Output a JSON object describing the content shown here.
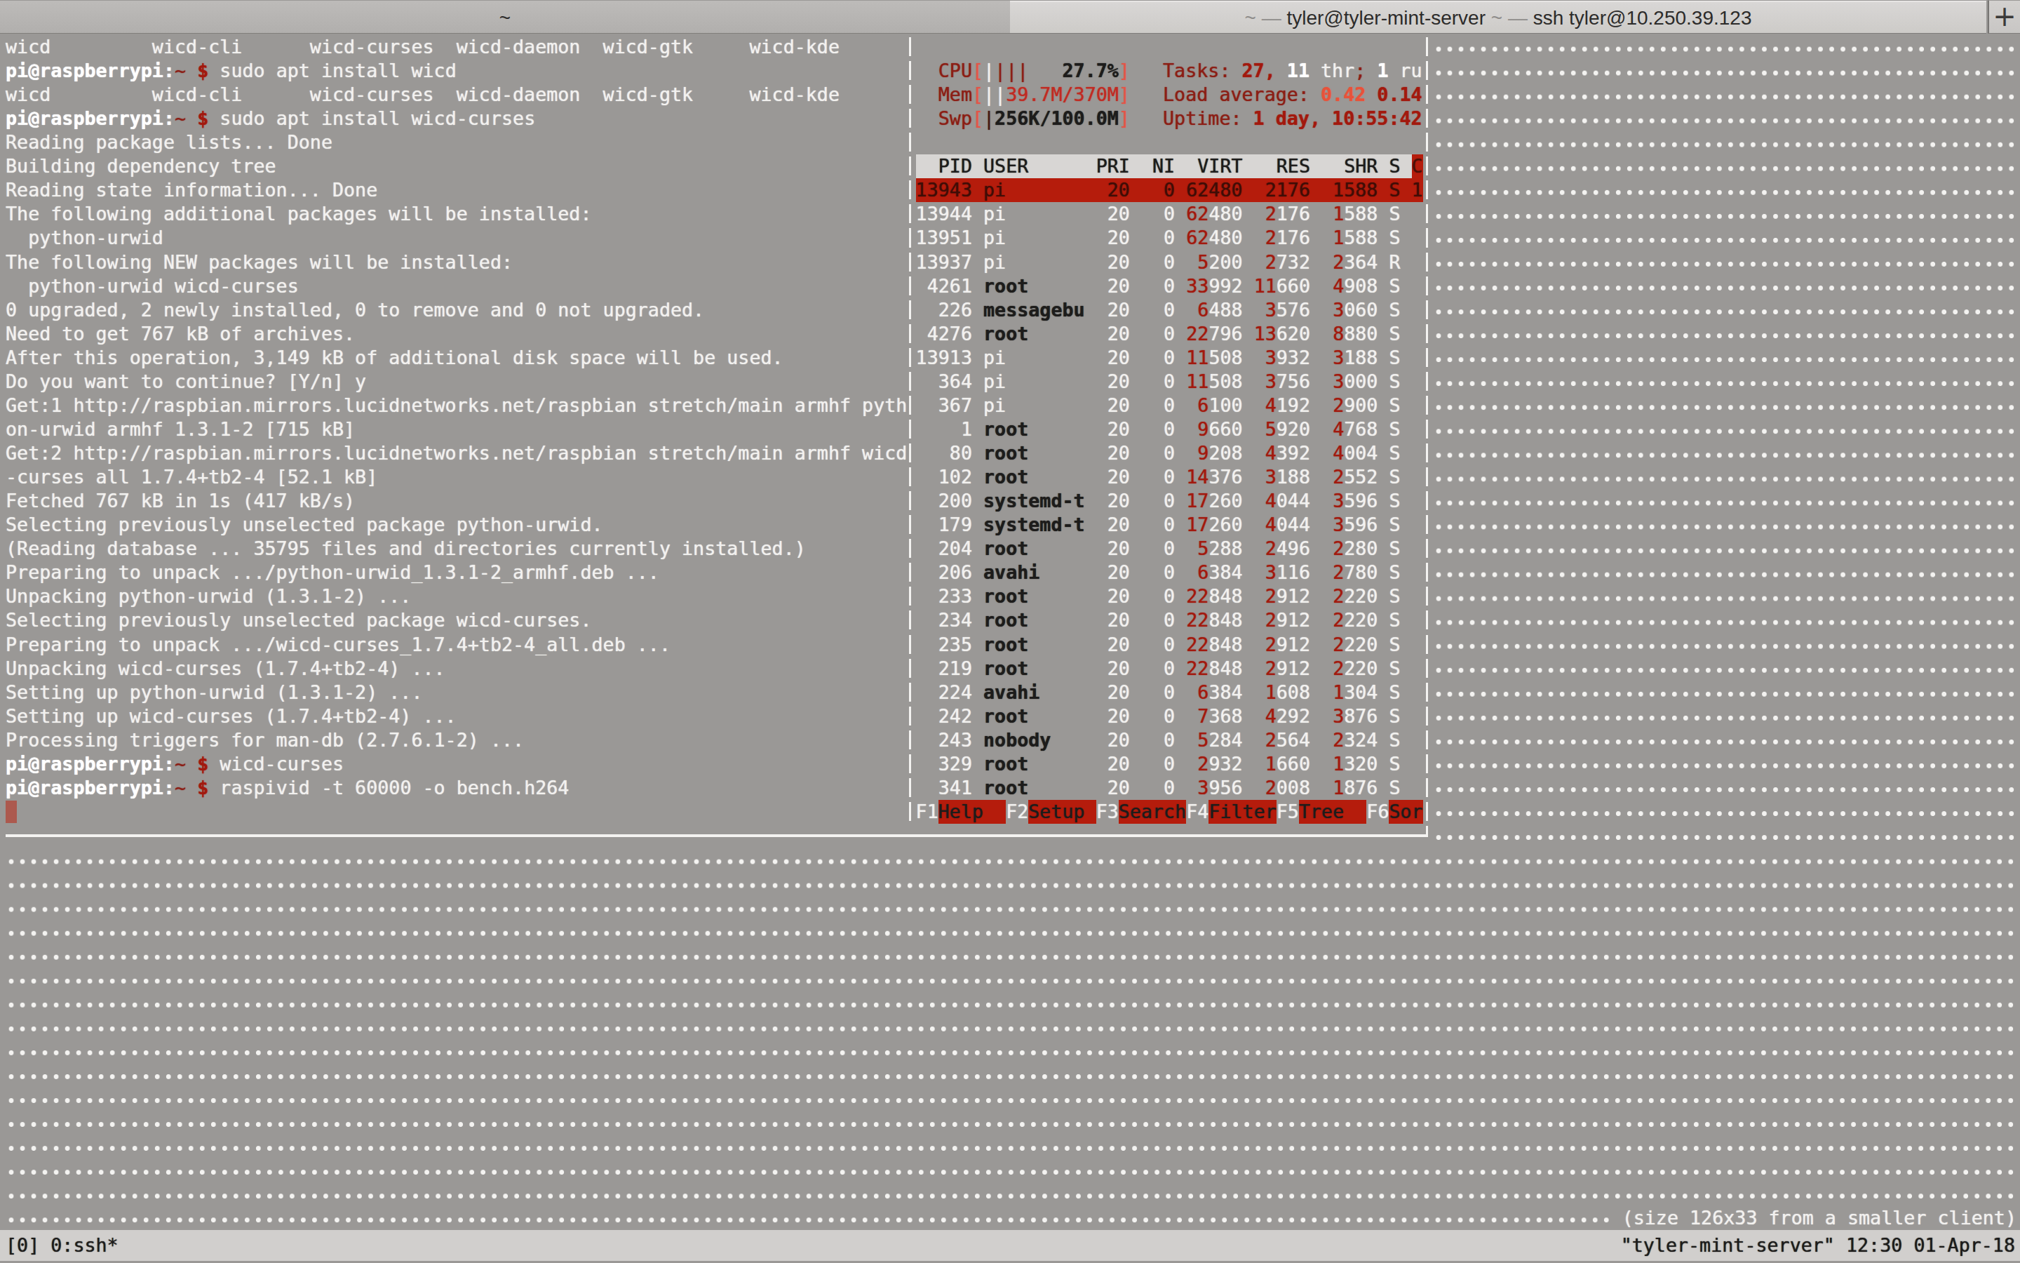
{
  "tabs": [
    {
      "title": "~",
      "active": false
    },
    {
      "title": "~ — tyler@tyler-mint-server ~ — ssh tyler@10.250.39.123",
      "active": true,
      "segments": [
        [
          "~ — ",
          "dim"
        ],
        [
          "tyler@tyler-mint-server",
          ""
        ],
        [
          " ~ — ",
          "dim"
        ],
        [
          "ssh tyler@10.250.39.123",
          ""
        ]
      ]
    }
  ],
  "new_tab_label": "+",
  "colors": {
    "bg": "#9a9896",
    "fg": "#f2f1ef",
    "boldfg": "#ffffff",
    "maroon": "#8b1e15",
    "crimson": "#a2190e",
    "bracket": "#e25548",
    "redval": "#c02b23",
    "tomato": "#e8523a",
    "black": "#1d1c1b",
    "selbg": "#b51c0c",
    "seltext": "#400d06",
    "hdrbg": "#d8d6d4",
    "sortfg": "#4c0f07",
    "border": "#f4f3f1",
    "dot": "#f4f3f1",
    "cursor": "#ac594e",
    "statusbg": "#d1cfcd",
    "swpbar": "#451710",
    "tabfg": "#2c2b2a",
    "tabdim": "#8e8c8a"
  },
  "shell": {
    "lines": [
      [
        [
          "wicd         wicd-cli      wicd-curses  wicd-daemon  wicd-gtk     wicd-kde",
          "f"
        ]
      ],
      [
        [
          "pi@raspberrypi:",
          "b"
        ],
        [
          "~",
          "m"
        ],
        [
          " ",
          "f"
        ],
        [
          "$",
          "d"
        ],
        [
          " sudo apt install wicd",
          "f"
        ]
      ],
      [
        [
          "wicd         wicd-cli      wicd-curses  wicd-daemon  wicd-gtk     wicd-kde",
          "f"
        ]
      ],
      [
        [
          "pi@raspberrypi:",
          "b"
        ],
        [
          "~",
          "m"
        ],
        [
          " ",
          "f"
        ],
        [
          "$",
          "d"
        ],
        [
          " sudo apt install wicd-curses",
          "f"
        ]
      ],
      [
        [
          "Reading package lists... Done",
          "f"
        ]
      ],
      [
        [
          "Building dependency tree",
          "f"
        ]
      ],
      [
        [
          "Reading state information... Done",
          "f"
        ]
      ],
      [
        [
          "The following additional packages will be installed:",
          "f"
        ]
      ],
      [
        [
          "  python-urwid",
          "f"
        ]
      ],
      [
        [
          "The following NEW packages will be installed:",
          "f"
        ]
      ],
      [
        [
          "  python-urwid wicd-curses",
          "f"
        ]
      ],
      [
        [
          "0 upgraded, 2 newly installed, 0 to remove and 0 not upgraded.",
          "f"
        ]
      ],
      [
        [
          "Need to get 767 kB of archives.",
          "f"
        ]
      ],
      [
        [
          "After this operation, 3,149 kB of additional disk space will be used.",
          "f"
        ]
      ],
      [
        [
          "Do you want to continue? [Y/n] y",
          "f"
        ]
      ],
      [
        [
          "Get:1 http://raspbian.mirrors.lucidnetworks.net/raspbian stretch/main armhf pyth",
          "f"
        ]
      ],
      [
        [
          "on-urwid armhf 1.3.1-2 [715 kB]",
          "f"
        ]
      ],
      [
        [
          "Get:2 http://raspbian.mirrors.lucidnetworks.net/raspbian stretch/main armhf wicd",
          "f"
        ]
      ],
      [
        [
          "-curses all 1.7.4+tb2-4 [52.1 kB]",
          "f"
        ]
      ],
      [
        [
          "Fetched 767 kB in 1s (417 kB/s)",
          "f"
        ]
      ],
      [
        [
          "Selecting previously unselected package python-urwid.",
          "f"
        ]
      ],
      [
        [
          "(Reading database ... 35795 files and directories currently installed.)",
          "f"
        ]
      ],
      [
        [
          "Preparing to unpack .../python-urwid_1.3.1-2_armhf.deb ...",
          "f"
        ]
      ],
      [
        [
          "Unpacking python-urwid (1.3.1-2) ...",
          "f"
        ]
      ],
      [
        [
          "Selecting previously unselected package wicd-curses.",
          "f"
        ]
      ],
      [
        [
          "Preparing to unpack .../wicd-curses_1.7.4+tb2-4_all.deb ...",
          "f"
        ]
      ],
      [
        [
          "Unpacking wicd-curses (1.7.4+tb2-4) ...",
          "f"
        ]
      ],
      [
        [
          "Setting up python-urwid (1.3.1-2) ...",
          "f"
        ]
      ],
      [
        [
          "Setting up wicd-curses (1.7.4+tb2-4) ...",
          "f"
        ]
      ],
      [
        [
          "Processing triggers for man-db (2.7.6.1-2) ...",
          "f"
        ]
      ],
      [
        [
          "pi@raspberrypi:",
          "b"
        ],
        [
          "~",
          "m"
        ],
        [
          " ",
          "f"
        ],
        [
          "$",
          "d"
        ],
        [
          " wicd-curses",
          "f"
        ]
      ],
      [
        [
          "pi@raspberrypi:",
          "b"
        ],
        [
          "~",
          "m"
        ],
        [
          " ",
          "f"
        ],
        [
          "$",
          "d"
        ],
        [
          " raspivid -t 60000 -o bench.h264",
          "f"
        ]
      ]
    ],
    "cursor_row": 32
  },
  "htop": {
    "meters_left": [
      [
        [
          "  ",
          "f"
        ],
        [
          "CPU",
          "m"
        ],
        [
          "[",
          "r"
        ],
        [
          "|",
          "f"
        ],
        [
          "|||",
          "m"
        ],
        [
          "   ",
          "f"
        ],
        [
          "27.7%",
          "kb"
        ],
        [
          "]",
          "r"
        ]
      ],
      [
        [
          "  ",
          "f"
        ],
        [
          "Mem",
          "m"
        ],
        [
          "[",
          "r"
        ],
        [
          "||",
          "f"
        ],
        [
          "39.7M/370M",
          "rv"
        ],
        [
          "]",
          "r"
        ]
      ],
      [
        [
          "  ",
          "f"
        ],
        [
          "Swp",
          "m"
        ],
        [
          "[",
          "r"
        ],
        [
          "|",
          "sb"
        ],
        [
          "256K/100.0M",
          "kb"
        ],
        [
          "]",
          "r"
        ]
      ]
    ],
    "meters_right": [
      [
        [
          "Tasks: ",
          "m"
        ],
        [
          "27,",
          "cb"
        ],
        [
          " ",
          "f"
        ],
        [
          "11",
          "wb"
        ],
        [
          " thr",
          "f"
        ],
        [
          ";",
          "m"
        ],
        [
          " ",
          "f"
        ],
        [
          "1",
          "wb"
        ],
        [
          " ru",
          "f"
        ]
      ],
      [
        [
          "Load average: ",
          "m"
        ],
        [
          "0.42",
          "tb"
        ],
        [
          " ",
          "f"
        ],
        [
          "0.14",
          "cb"
        ]
      ],
      [
        [
          "Uptime: ",
          "m"
        ],
        [
          "1 day, 10:55:42",
          "cb"
        ]
      ]
    ],
    "header_cols": "  PID USER      PRI  NI  VIRT   RES   SHR S ",
    "sort_col": "C",
    "processes": [
      [
        13943,
        "pi",
        20,
        0,
        62480,
        2176,
        1588,
        "S",
        "1"
      ],
      [
        13944,
        "pi",
        20,
        0,
        62480,
        2176,
        1588,
        "S",
        " "
      ],
      [
        13951,
        "pi",
        20,
        0,
        62480,
        2176,
        1588,
        "S",
        " "
      ],
      [
        13937,
        "pi",
        20,
        0,
        5200,
        2732,
        2364,
        "R",
        " "
      ],
      [
        4261,
        "root",
        20,
        0,
        33992,
        11660,
        4908,
        "S",
        " "
      ],
      [
        226,
        "messagebu",
        20,
        0,
        6488,
        3576,
        3060,
        "S",
        " "
      ],
      [
        4276,
        "root",
        20,
        0,
        22796,
        13620,
        8880,
        "S",
        " "
      ],
      [
        13913,
        "pi",
        20,
        0,
        11508,
        3932,
        3188,
        "S",
        " "
      ],
      [
        364,
        "pi",
        20,
        0,
        11508,
        3756,
        3000,
        "S",
        " "
      ],
      [
        367,
        "pi",
        20,
        0,
        6100,
        4192,
        2900,
        "S",
        " "
      ],
      [
        1,
        "root",
        20,
        0,
        9660,
        5920,
        4768,
        "S",
        " "
      ],
      [
        80,
        "root",
        20,
        0,
        9208,
        4392,
        4004,
        "S",
        " "
      ],
      [
        102,
        "root",
        20,
        0,
        14376,
        3188,
        2552,
        "S",
        " "
      ],
      [
        200,
        "systemd-t",
        20,
        0,
        17260,
        4044,
        3596,
        "S",
        " "
      ],
      [
        179,
        "systemd-t",
        20,
        0,
        17260,
        4044,
        3596,
        "S",
        " "
      ],
      [
        204,
        "root",
        20,
        0,
        5288,
        2496,
        2280,
        "S",
        " "
      ],
      [
        206,
        "avahi",
        20,
        0,
        6384,
        3116,
        2780,
        "S",
        " "
      ],
      [
        233,
        "root",
        20,
        0,
        22848,
        2912,
        2220,
        "S",
        " "
      ],
      [
        234,
        "root",
        20,
        0,
        22848,
        2912,
        2220,
        "S",
        " "
      ],
      [
        235,
        "root",
        20,
        0,
        22848,
        2912,
        2220,
        "S",
        " "
      ],
      [
        219,
        "root",
        20,
        0,
        22848,
        2912,
        2220,
        "S",
        " "
      ],
      [
        224,
        "avahi",
        20,
        0,
        6384,
        1608,
        1304,
        "S",
        " "
      ],
      [
        242,
        "root",
        20,
        0,
        7368,
        4292,
        3876,
        "S",
        " "
      ],
      [
        243,
        "nobody",
        20,
        0,
        5284,
        2564,
        2324,
        "S",
        " "
      ],
      [
        329,
        "root",
        20,
        0,
        2932,
        1660,
        1320,
        "S",
        " "
      ],
      [
        341,
        "root",
        20,
        0,
        3956,
        2008,
        1876,
        "S",
        " "
      ]
    ],
    "selected_index": 0,
    "current_user": "pi",
    "fkeys": [
      [
        "F1",
        "Help  "
      ],
      [
        "F2",
        "Setup "
      ],
      [
        "F3",
        "Search"
      ],
      [
        "F4",
        "Filter"
      ],
      [
        "F5",
        "Tree  "
      ],
      [
        "F6",
        "Sor"
      ]
    ]
  },
  "status": {
    "left": "[0] 0:ssh*",
    "right": "\"tyler-mint-server\" 12:30 01-Apr-18"
  },
  "size_message": "(size 126x33 from a smaller client)"
}
